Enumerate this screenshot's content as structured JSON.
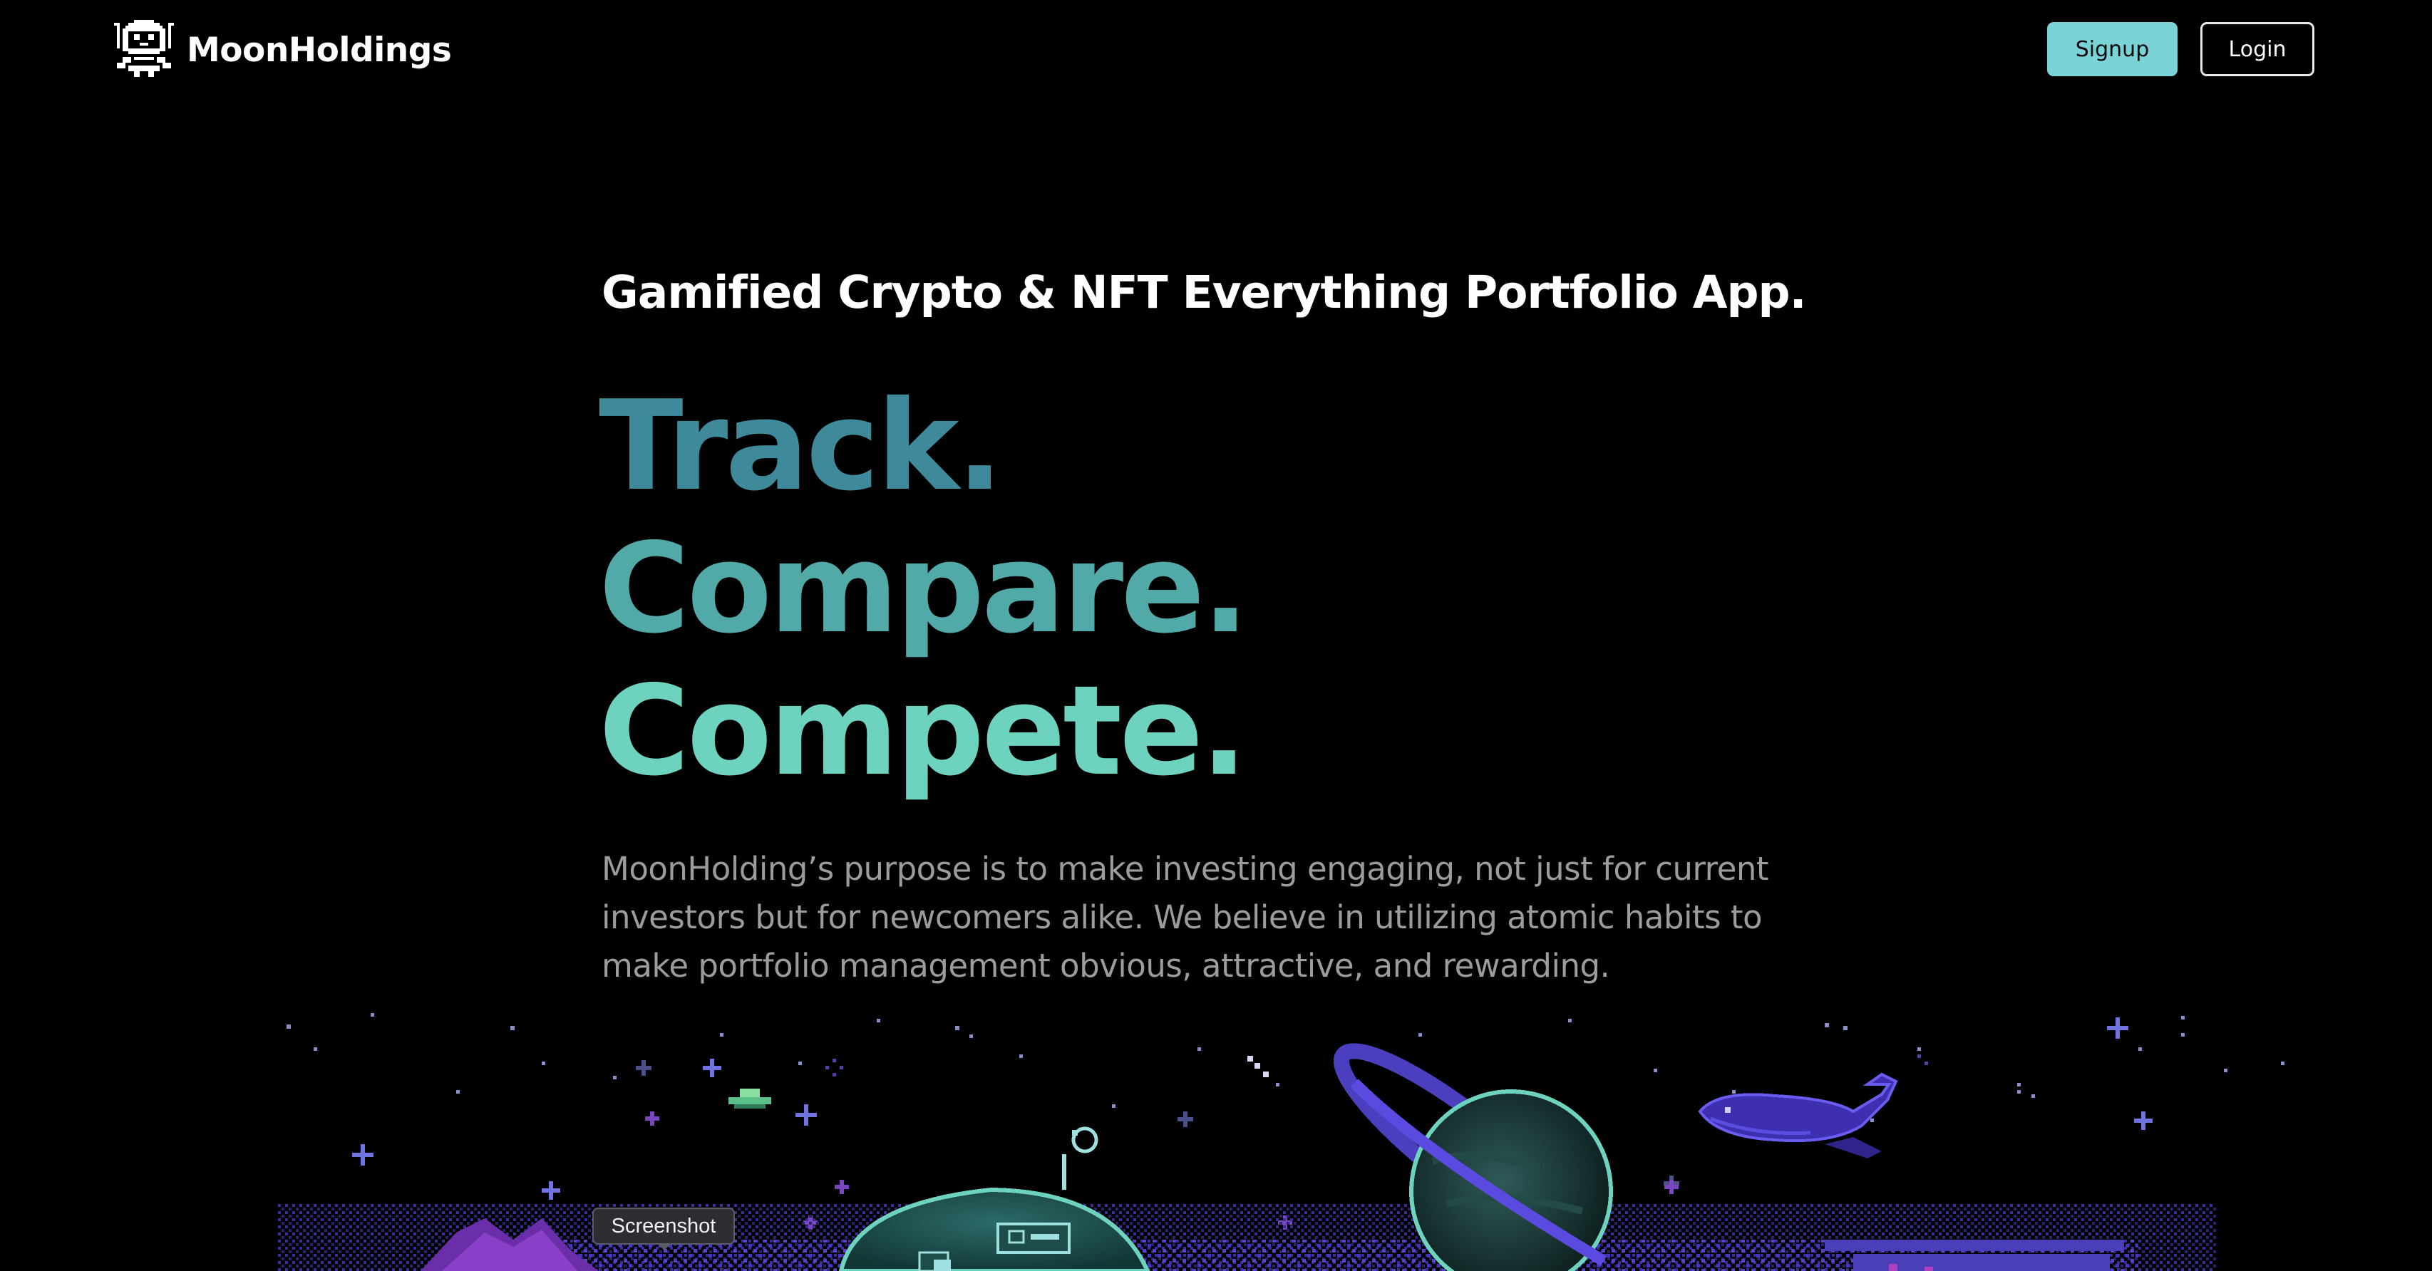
{
  "header": {
    "brand": "MoonHoldings",
    "signup_label": "Signup",
    "login_label": "Login"
  },
  "hero": {
    "tagline": "Gamified Crypto & NFT Everything Portfolio App.",
    "line1": "Track.",
    "line2": "Compare.",
    "line3": "Compete.",
    "description": "MoonHolding’s purpose is to make investing engaging, not just for current investors but for newcomers alike.  We believe in utilizing atomic habits to make portfolio management obvious, attractive, and rewarding."
  },
  "tooltip": {
    "label": "Screenshot"
  },
  "colors": {
    "background": "#000000",
    "accent_button": "#7ad3d6",
    "track": "#3e8a9a",
    "compare": "#52aaa8",
    "compete": "#6dd3bf",
    "body_text": "#9c9c9c"
  },
  "icons": {
    "logo": "astronaut-pixel-icon"
  }
}
